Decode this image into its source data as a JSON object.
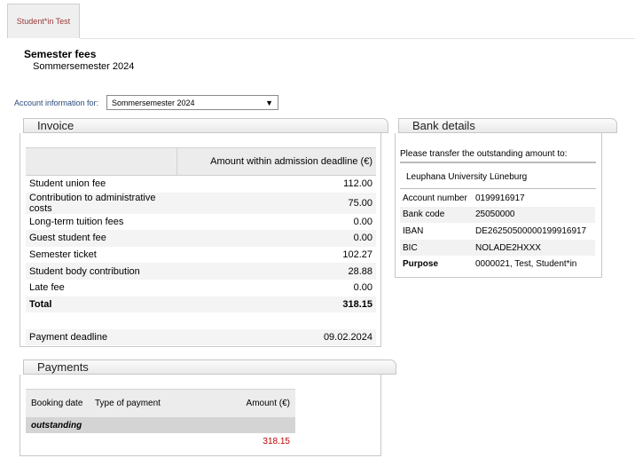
{
  "tab": {
    "label": "Student*in Test"
  },
  "header": {
    "title": "Semester fees",
    "subtitle": "Sommersemester 2024"
  },
  "account": {
    "label": "Account information for:",
    "selected": "Sommersemester 2024"
  },
  "invoice": {
    "title": "Invoice",
    "column_header": "Amount within admission deadline (€)",
    "rows": [
      {
        "label": "Student union fee",
        "value": "112.00"
      },
      {
        "label": "Contribution to administrative costs",
        "value": "75.00"
      },
      {
        "label": "Long-term tuition fees",
        "value": "0.00"
      },
      {
        "label": "Guest student fee",
        "value": "0.00"
      },
      {
        "label": "Semester ticket",
        "value": "102.27"
      },
      {
        "label": "Student body contribution",
        "value": "28.88"
      },
      {
        "label": "Late fee",
        "value": "0.00"
      }
    ],
    "total_label": "Total",
    "total_value": "318.15",
    "deadline_label": "Payment deadline",
    "deadline_value": "09.02.2024"
  },
  "bank": {
    "title": "Bank details",
    "intro": "Please transfer the outstanding amount to:",
    "university": "Leuphana University Lüneburg",
    "rows": [
      {
        "label": "Account number",
        "value": "0199916917"
      },
      {
        "label": "Bank code",
        "value": "25050000"
      },
      {
        "label": "IBAN",
        "value": "DE26250500000199916917"
      },
      {
        "label": "BIC",
        "value": "NOLADE2HXXX"
      },
      {
        "label": "Purpose",
        "value": "0000021, Test, Student*in"
      }
    ]
  },
  "payments": {
    "title": "Payments",
    "columns": [
      "Booking date",
      "Type of payment",
      "Amount (€)"
    ],
    "status_row": "outstanding",
    "amount": "318.15"
  }
}
